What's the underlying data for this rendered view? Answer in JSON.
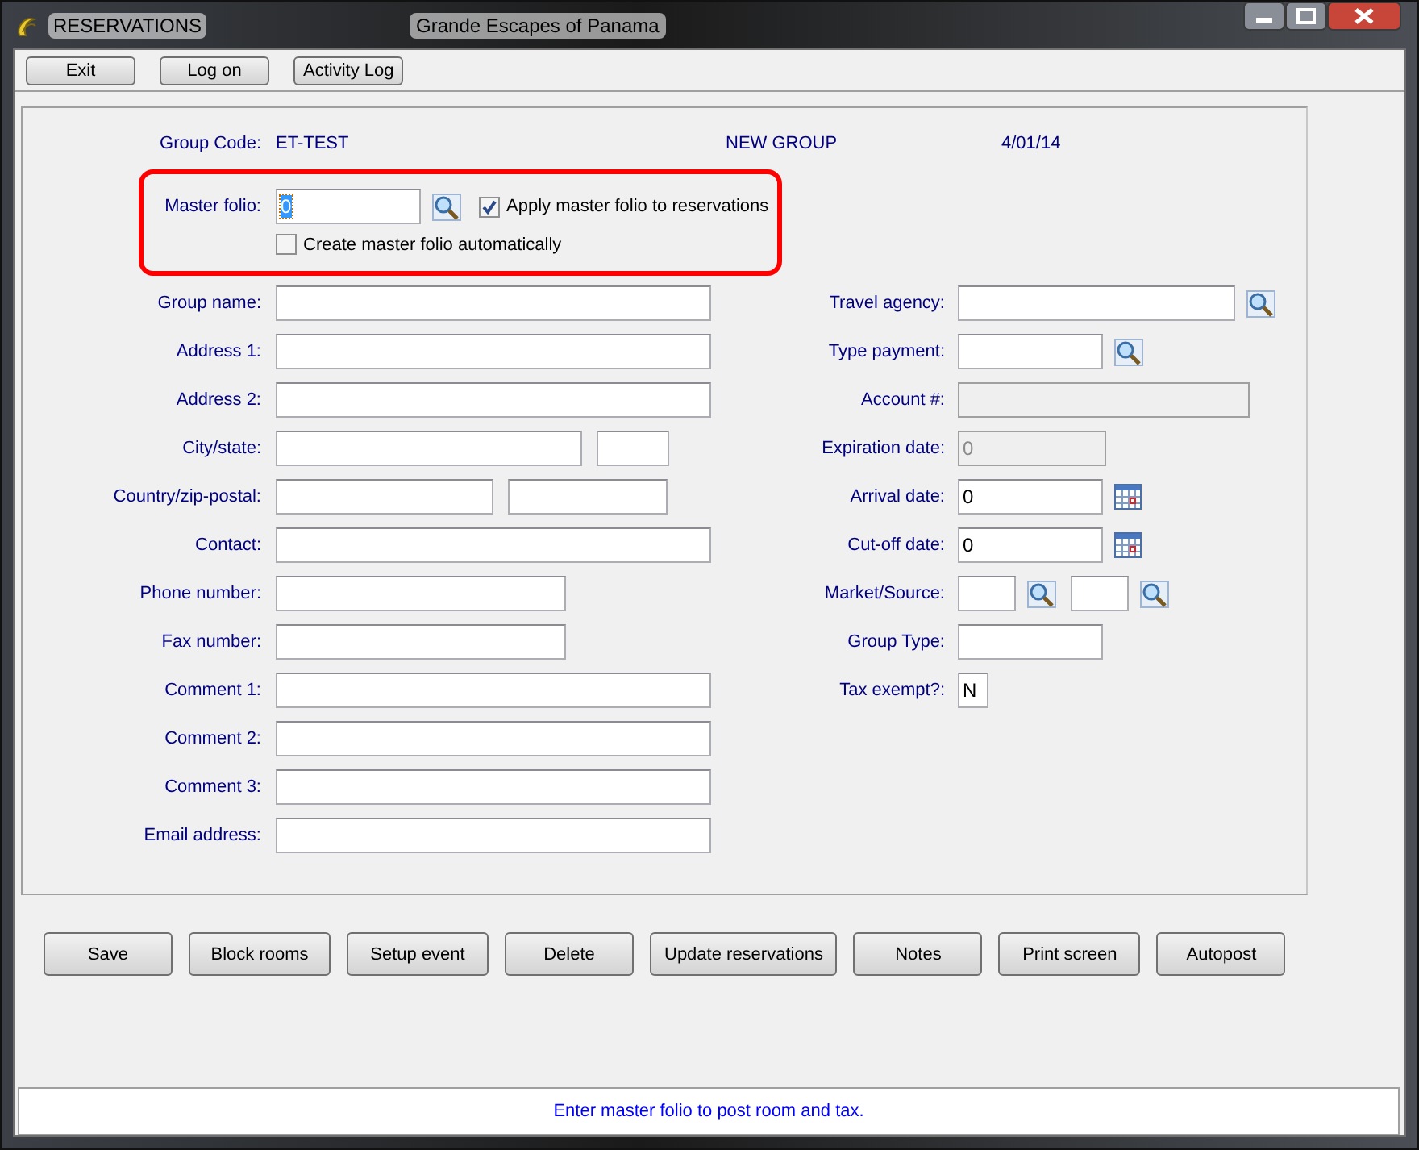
{
  "window": {
    "title": "RESERVATIONS",
    "subtitle": "Grande Escapes of Panama"
  },
  "toolbar": [
    "Exit",
    "Log on",
    "Activity Log"
  ],
  "header": {
    "group_code_label": "Group Code:",
    "group_code": "ET-TEST",
    "status": "NEW GROUP",
    "date": "4/01/14"
  },
  "master_folio": {
    "label": "Master folio:",
    "value": "0",
    "value_selected": true,
    "kind": "lookup",
    "checkboxes": [
      {
        "label": "Apply master folio to reservations",
        "checked": true
      },
      {
        "label": "Create master folio automatically",
        "checked": false
      }
    ]
  },
  "left_fields": [
    {
      "label": "Group name:",
      "inputs": [
        {
          "disabled": false
        }
      ]
    },
    {
      "label": "Address 1:",
      "inputs": [
        {
          "disabled": false
        }
      ]
    },
    {
      "label": "Address 2:",
      "inputs": [
        {
          "disabled": false
        }
      ]
    },
    {
      "label": "City/state:",
      "inputs": [
        {
          "disabled": false
        },
        {
          "disabled": false
        }
      ]
    },
    {
      "label": "Country/zip-postal:",
      "inputs": [
        {
          "disabled": false
        },
        {
          "disabled": false
        }
      ]
    },
    {
      "label": "Contact:",
      "inputs": [
        {
          "disabled": false
        }
      ]
    },
    {
      "label": "Phone number:",
      "inputs": [
        {
          "disabled": false
        }
      ]
    },
    {
      "label": "Fax number:",
      "inputs": [
        {
          "disabled": false
        }
      ]
    },
    {
      "label": "Comment 1:",
      "inputs": [
        {
          "disabled": false
        }
      ]
    },
    {
      "label": "Comment 2:",
      "inputs": [
        {
          "disabled": false
        }
      ]
    },
    {
      "label": "Comment 3:",
      "inputs": [
        {
          "disabled": false
        }
      ]
    },
    {
      "label": "Email address:",
      "inputs": [
        {
          "disabled": false
        }
      ]
    }
  ],
  "right_fields": [
    {
      "label": "Travel agency:",
      "inputs": [
        {
          "disabled": false,
          "kind": "lookup"
        }
      ]
    },
    {
      "label": "Type payment:",
      "inputs": [
        {
          "disabled": false,
          "kind": "lookup"
        }
      ]
    },
    {
      "label": "Account #:",
      "inputs": [
        {
          "disabled": true
        }
      ]
    },
    {
      "label": "Expiration date:",
      "inputs": [
        {
          "value": "0",
          "disabled": true
        }
      ]
    },
    {
      "label": "Arrival date:",
      "inputs": [
        {
          "value": "0",
          "disabled": false,
          "kind": "calendar"
        }
      ]
    },
    {
      "label": "Cut-off date:",
      "inputs": [
        {
          "value": "0",
          "disabled": false,
          "kind": "calendar"
        }
      ]
    },
    {
      "label": "Market/Source:",
      "inputs": [
        {
          "disabled": false,
          "kind": "lookup"
        },
        {
          "disabled": false,
          "kind": "lookup"
        }
      ]
    },
    {
      "label": "Group Type:",
      "inputs": [
        {
          "disabled": false
        }
      ]
    },
    {
      "label": "Tax exempt?:",
      "inputs": [
        {
          "value": "N",
          "disabled": false
        }
      ]
    }
  ],
  "buttons": [
    "Save",
    "Block rooms",
    "Setup event",
    "Delete",
    "Update reservations",
    "Notes",
    "Print screen",
    "Autopost"
  ],
  "status_bar": "Enter master folio to post room and tax."
}
